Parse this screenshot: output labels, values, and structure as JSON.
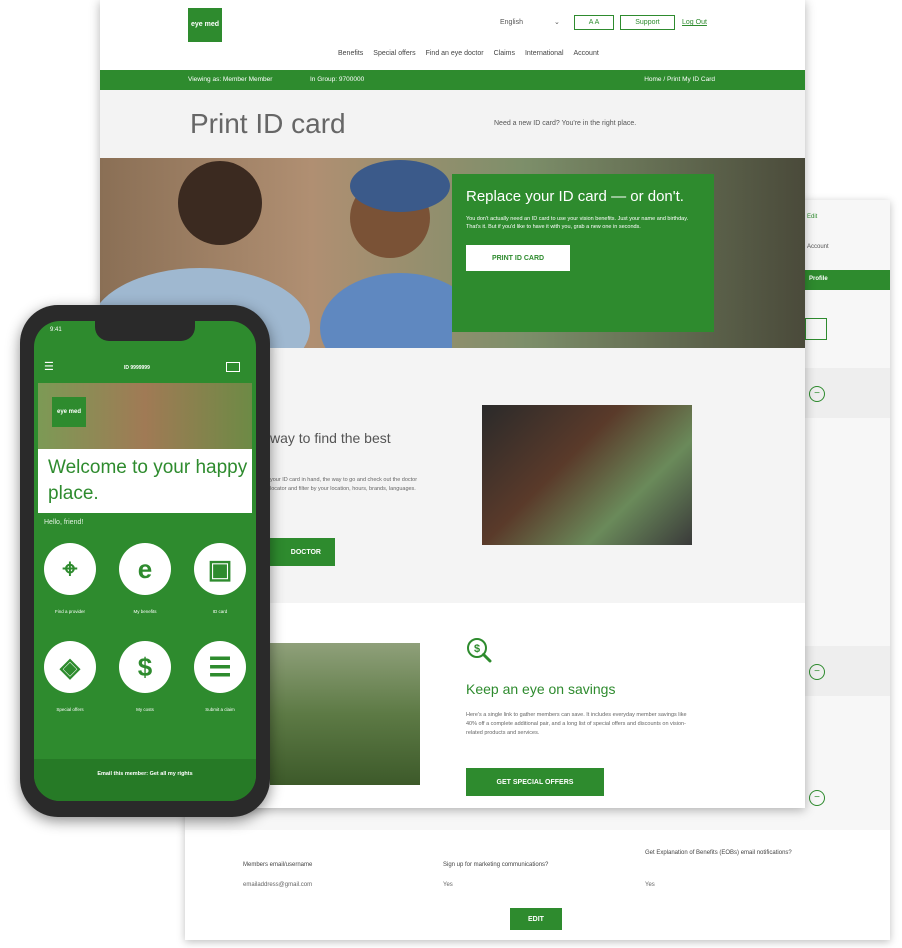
{
  "colors": {
    "brand_green": "#2e8b2e",
    "page_bg": "#f4f4f4"
  },
  "header": {
    "logo_text": "eye med",
    "language": "English",
    "text_size_button": "A A",
    "support_button": "Support",
    "logout_link": "Log Out",
    "nav": [
      "Benefits",
      "Special offers",
      "Find an eye doctor",
      "Claims",
      "International",
      "Account"
    ]
  },
  "greenbar": {
    "viewing": "Viewing as: Member Member",
    "group": "In Group: 9700000",
    "breadcrumb": "Home / Print My ID Card"
  },
  "title_band": {
    "title": "Print ID card",
    "subtitle": "Need a new ID card? You're in the right place."
  },
  "hero": {
    "heading": "Replace your ID card — or don't.",
    "body": "You don't actually need an ID card to use your vision benefits. Just your name and birthday. That's it. But if you'd like to have it with you, grab a new one in seconds.",
    "button": "PRINT ID CARD"
  },
  "find_section": {
    "heading": "way to find the best",
    "body": "your ID card in hand, the way to go and check out the doctor locator and filter by your location, hours, brands, languages.",
    "button": "DOCTOR"
  },
  "savings_section": {
    "icon": "dollar-search-icon",
    "heading": "Keep an eye on savings",
    "body": "Here's a single link to gather members can save. It includes everyday member savings like 40% off a complete additional pair, and a long list of special offers and discounts on vision-related products and services.",
    "button": "GET SPECIAL OFFERS"
  },
  "back_window": {
    "link": "Edit",
    "select_label": "Account",
    "strip_label": "Profile",
    "footer": {
      "col1_label": "Members email/username",
      "col1_value": "emailaddress@gmail.com",
      "col2_label": "Sign up for marketing communications?",
      "col2_value": "Yes",
      "col3_label": "Get Explanation of Benefits (EOBs) email notifications?",
      "col3_value": "Yes",
      "edit_button": "EDIT"
    }
  },
  "phone": {
    "time": "9:41",
    "member_id": "ID 9999999",
    "logo_text": "eye med",
    "welcome": "Welcome to your happy place.",
    "hello": "Hello, friend!",
    "tiles": [
      {
        "icon": "map-pin-icon",
        "glyph": "⌖",
        "label": "Find a provider"
      },
      {
        "icon": "e-logo-icon",
        "glyph": "e",
        "label": "My benefits"
      },
      {
        "icon": "id-card-icon",
        "glyph": "▣",
        "label": "ID card"
      },
      {
        "icon": "tag-icon",
        "glyph": "◈",
        "label": "Special offers"
      },
      {
        "icon": "dollar-icon",
        "glyph": "$",
        "label": "My costs"
      },
      {
        "icon": "clipboard-icon",
        "glyph": "☰",
        "label": "Submit a claim"
      }
    ],
    "footer": "Email this member: Get all my rights"
  }
}
